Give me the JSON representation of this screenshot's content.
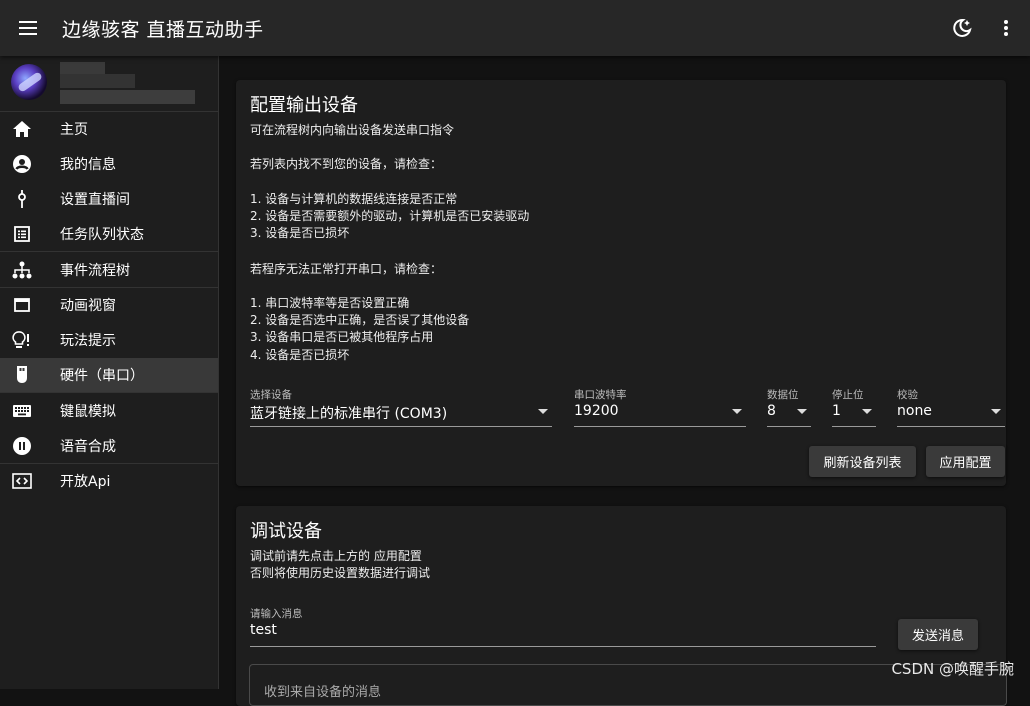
{
  "app": {
    "title": "边缘骇客 直播互动助手"
  },
  "nav": {
    "items": [
      {
        "label": "主页"
      },
      {
        "label": "我的信息"
      },
      {
        "label": "设置直播间"
      },
      {
        "label": "任务队列状态"
      },
      {
        "label": "事件流程树"
      },
      {
        "label": "动画视窗"
      },
      {
        "label": "玩法提示"
      },
      {
        "label": "硬件（串口）"
      },
      {
        "label": "键鼠模拟"
      },
      {
        "label": "语音合成"
      },
      {
        "label": "开放Api"
      }
    ]
  },
  "config": {
    "title": "配置输出设备",
    "line1": "可在流程树内向输出设备发送串口指令",
    "line2": "若列表内找不到您的设备，请检查：",
    "check1": "1. 设备与计算机的数据线连接是否正常",
    "check2": "2. 设备是否需要额外的驱动，计算机是否已安装驱动",
    "check3": "3. 设备是否已损坏",
    "line3": "若程序无法正常打开串口，请检查：",
    "open1": "1. 串口波特率等是否设置正确",
    "open2": "2. 设备是否选中正确，是否误了其他设备",
    "open3": "3. 设备串口是否已被其他程序占用",
    "open4": "4. 设备是否已损坏",
    "device_label": "选择设备",
    "device_value": "蓝牙链接上的标准串行 (COM3)",
    "baud_label": "串口波特率",
    "baud_value": "19200",
    "databits_label": "数据位",
    "databits_value": "8",
    "stopbits_label": "停止位",
    "stopbits_value": "1",
    "parity_label": "校验",
    "parity_value": "none",
    "refresh_button": "刷新设备列表",
    "apply_button": "应用配置"
  },
  "debug": {
    "title": "调试设备",
    "note1": "调试前请先点击上方的 应用配置",
    "note2": "否则将使用历史设置数据进行调试",
    "input_label": "请输入消息",
    "input_value": "test",
    "send_button": "发送消息",
    "received_label": "收到来自设备的消息"
  },
  "watermark": "CSDN @唤醒手腕"
}
